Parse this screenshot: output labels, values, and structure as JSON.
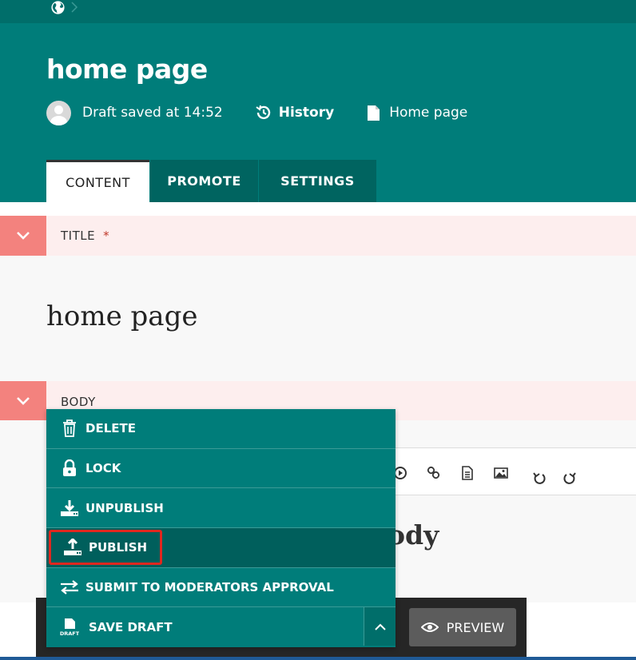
{
  "header": {
    "title": "home page",
    "draft_status": "Draft saved at 14:52",
    "history_label": "History",
    "page_type_label": "Home page"
  },
  "tabs": [
    {
      "label": "CONTENT",
      "active": true
    },
    {
      "label": "PROMOTE",
      "active": false
    },
    {
      "label": "SETTINGS",
      "active": false
    }
  ],
  "fields": {
    "title": {
      "label": "TITLE",
      "required_mark": "*",
      "value": "home page"
    },
    "body": {
      "label": "BODY",
      "visible_text": "ody"
    }
  },
  "actions_menu": {
    "items": [
      {
        "label": "DELETE",
        "icon": "trash-icon"
      },
      {
        "label": "LOCK",
        "icon": "lock-icon"
      },
      {
        "label": "UNPUBLISH",
        "icon": "download-tray-icon"
      },
      {
        "label": "PUBLISH",
        "icon": "upload-tray-icon",
        "highlighted": true
      },
      {
        "label": "SUBMIT TO MODERATORS APPROVAL",
        "icon": "swap-arrows-icon"
      },
      {
        "label": "SAVE DRAFT",
        "icon": "draft-doc-icon",
        "icon_text": "DRAFT"
      }
    ]
  },
  "preview_label": "PREVIEW",
  "colors": {
    "header_teal": "#007d7a",
    "dark_teal": "#005f5c",
    "field_header_pink": "#fdeeee",
    "toggle_salmon": "#f3827e",
    "highlight_red": "#e0271f",
    "preview_gray": "#5c5c5c"
  }
}
